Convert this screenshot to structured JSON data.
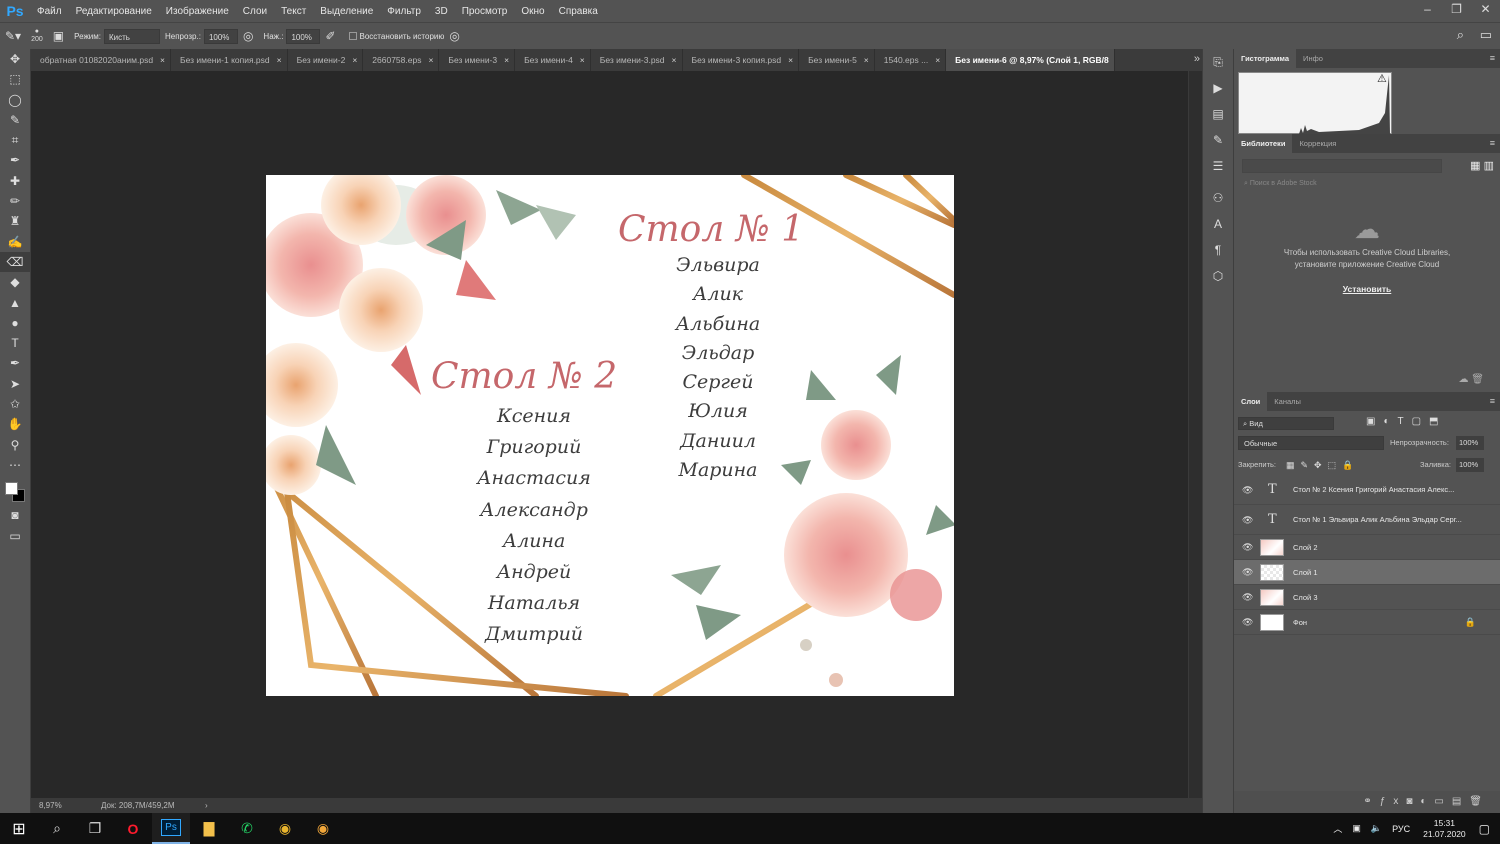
{
  "app": {
    "logo": "Ps"
  },
  "menu": [
    "Файл",
    "Редактирование",
    "Изображение",
    "Слои",
    "Текст",
    "Выделение",
    "Фильтр",
    "3D",
    "Просмотр",
    "Окно",
    "Справка"
  ],
  "window_controls": [
    "–",
    "❐",
    "✕"
  ],
  "options": {
    "brush_size": "200",
    "mode_label": "Режим:",
    "mode_value": "Кисть",
    "opacity_label": "Непрозр.:",
    "opacity_value": "100%",
    "flow_label": "Наж.:",
    "flow_value": "100%",
    "history_label": "Восстановить историю"
  },
  "tabs": [
    {
      "label": "обратная 01082020аним.psd",
      "active": false
    },
    {
      "label": "Без имени-1 копия.psd",
      "active": false
    },
    {
      "label": "Без имени-2",
      "active": false
    },
    {
      "label": "2660758.eps",
      "active": false
    },
    {
      "label": "Без имени-3",
      "active": false
    },
    {
      "label": "Без имени-4",
      "active": false
    },
    {
      "label": "Без имени-3.psd",
      "active": false
    },
    {
      "label": "Без имени-3 копия.psd",
      "active": false
    },
    {
      "label": "Без имени-5",
      "active": false
    },
    {
      "label": "1540.eps ...",
      "active": false
    },
    {
      "label": "Без имени-6 @ 8,97% (Слой 1, RGB/8",
      "active": true
    }
  ],
  "document": {
    "table1_title": "Стол № 1",
    "table1_names": [
      "Эльвира",
      "Алик",
      "Альбина",
      "Эльдар",
      "Сергей",
      "Юлия",
      "Даниил",
      "Марина"
    ],
    "table2_title": "Стол № 2",
    "table2_names": [
      "Ксения",
      "Григорий",
      "Анастасия",
      "Александр",
      "Алина",
      "Андрей",
      "Наталья",
      "Дмитрий"
    ]
  },
  "status": {
    "zoom": "8,97%",
    "doc": "Док: 208,7M/459,2M"
  },
  "panels": {
    "histogram_tabs": [
      "Гистограмма",
      "Инфо"
    ],
    "library_tabs": [
      "Библиотеки",
      "Коррекция"
    ],
    "library_search": "Поиск в Adobe Stock",
    "library_message": "Чтобы использовать Creative Cloud Libraries, установите приложение Creative Cloud",
    "library_install": "Установить",
    "layers_tabs": [
      "Слои",
      "Каналы"
    ],
    "filter_label": "Вид",
    "blend_mode": "Обычные",
    "opacity_label": "Непрозрачность:",
    "opacity_value": "100%",
    "lock_label": "Закрепить:",
    "fill_label": "Заливка:",
    "fill_value": "100%",
    "layers": [
      {
        "name": "Стол № 2 Ксения Григорий Анастасия Алекс...",
        "type": "text"
      },
      {
        "name": "Стол № 1 Эльвира Алик Альбина Эльдар Серг...",
        "type": "text"
      },
      {
        "name": "Слой 2",
        "type": "image"
      },
      {
        "name": "Слой 1",
        "type": "image",
        "selected": true
      },
      {
        "name": "Слой 3",
        "type": "image"
      },
      {
        "name": "Фон",
        "type": "background"
      }
    ]
  },
  "taskbar": {
    "lang": "РУС",
    "time": "15:31",
    "date": "21.07.2020"
  }
}
